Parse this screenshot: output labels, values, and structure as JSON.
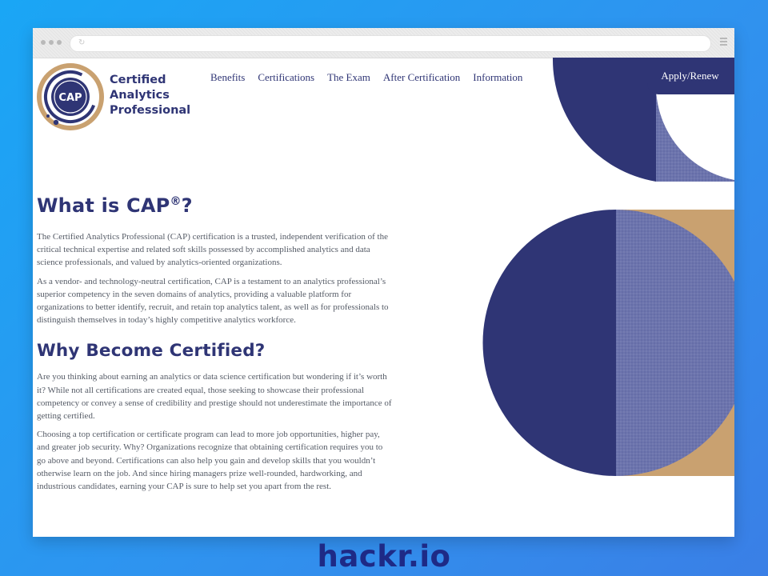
{
  "site": {
    "brand_lines": [
      "Certified",
      "Analytics",
      "Professional"
    ],
    "logo_text": "CAP",
    "nav": [
      "Benefits",
      "Certifications",
      "The Exam",
      "After Certification",
      "Information"
    ],
    "cta": "Apply/Renew"
  },
  "content": {
    "h1": "What is CAP",
    "h1_mark": "®",
    "h1_tail": "?",
    "p1": "The Certified Analytics Professional (CAP) certification is a trusted, independent verification of the critical technical expertise and related soft skills possessed by accomplished analytics and data science professionals, and valued by analytics-oriented organizations.",
    "p2": "As a vendor- and technology-neutral certification, CAP is a testament to an analytics professional’s superior competency in the seven domains of analytics, providing a valuable platform for organizations to better identify, recruit, and retain top analytics talent, as well as for professionals to distinguish themselves in today’s highly competitive analytics workforce.",
    "h2": "Why Become Certified?",
    "p3": "Are you thinking about earning an analytics or data science certification but wondering if it’s worth it? While not all certifications are created equal, those seeking to showcase their professional competency or convey a sense of credibility and prestige should not underestimate the importance of getting certified.",
    "p4": "Choosing a top certification or certificate program can lead to more job opportunities, higher pay, and greater job security. Why? Organizations recognize that obtaining certification requires you to go above and beyond. Certifications can also help you gain and develop skills that you wouldn’t otherwise learn on the job. And since hiring managers prize well-rounded, hardworking, and industrious candidates, earning your CAP is sure to help set you apart from the rest."
  },
  "watermark": "hackr.io",
  "colors": {
    "navy": "#2f3575",
    "periwinkle": "#6c74ad",
    "tan": "#c9a170",
    "background": "#1aa6f5"
  }
}
